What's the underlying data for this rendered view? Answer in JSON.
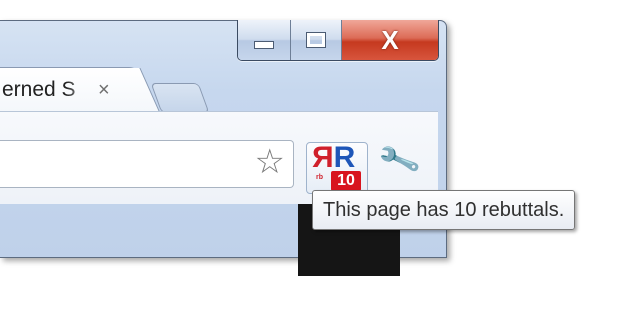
{
  "window": {
    "caption_buttons": {
      "minimize_icon": "minimize-icon",
      "maximize_icon": "maximize-icon",
      "close_glyph": "X"
    }
  },
  "tabs": [
    {
      "title": "erned S",
      "close_glyph": "×",
      "active": true
    }
  ],
  "new_tab": {
    "icon": "new-tab-icon"
  },
  "toolbar": {
    "bookmark_star_glyph": "☆",
    "extension": {
      "logo_letters": [
        "R",
        "R"
      ],
      "logo_small_text": "rb",
      "badge_count": "10"
    },
    "wrench_glyph": "🔧"
  },
  "tooltip": {
    "text": "This page has 10 rebuttals."
  },
  "colors": {
    "close_button": "#c5391f",
    "badge": "#d8141e",
    "logo_red": "#d0202b",
    "logo_blue": "#1e56b8"
  }
}
